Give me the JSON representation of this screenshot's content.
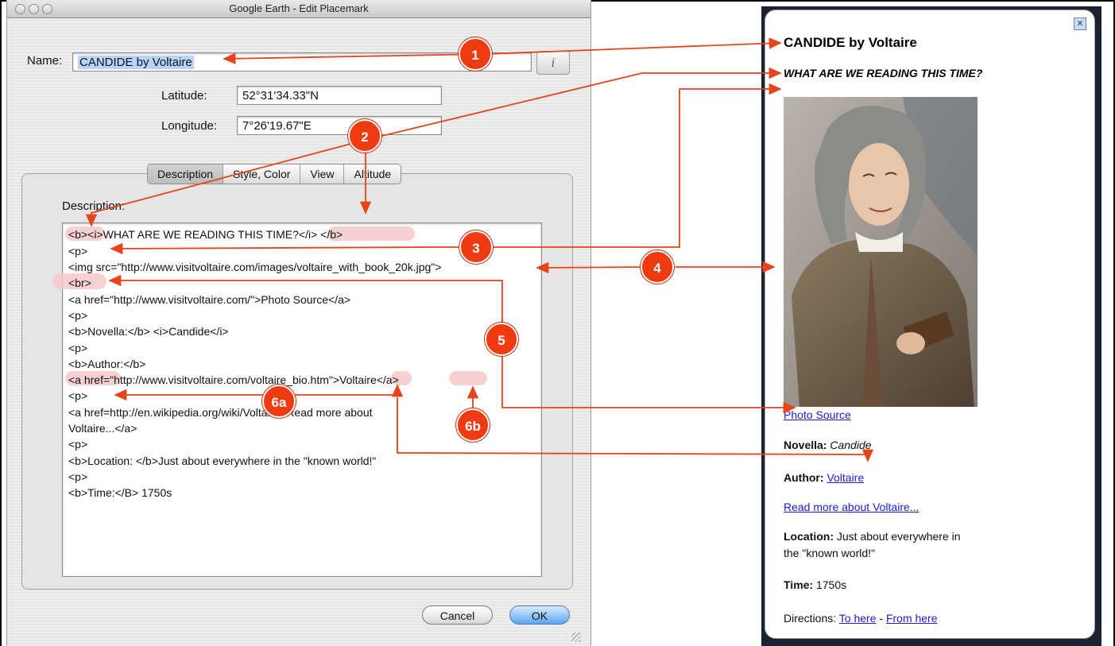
{
  "window": {
    "title": "Google Earth - Edit Placemark",
    "name_label": "Name:",
    "name_value": "CANDIDE by Voltaire",
    "info_button": "i",
    "latitude_label": "Latitude:",
    "latitude_value": "52°31'34.33\"N",
    "longitude_label": "Longitude:",
    "longitude_value": "7°26'19.67\"E",
    "tabs": [
      {
        "label": "Description",
        "active": true
      },
      {
        "label": "Style, Color",
        "active": false
      },
      {
        "label": "View",
        "active": false
      },
      {
        "label": "Altitude",
        "active": false
      }
    ],
    "description_label": "Description:",
    "description_lines": [
      "<b><i>WHAT ARE WE READING THIS TIME?</i> </b>",
      "<p>",
      "<img src=\"http://www.visitvoltaire.com/images/voltaire_with_book_20k.jpg\">",
      "<br>",
      "<a href=\"http://www.visitvoltaire.com/\">Photo Source</a>",
      "<p>",
      "<b>Novella:</b> <i>Candide</i>",
      "<p>",
      "<b>Author:</b>",
      "<a href=\"http://www.visitvoltaire.com/voltaire_bio.htm\">Voltaire</a>",
      "<p>",
      "<a href=http://en.wikipedia.org/wiki/Voltaire>Read more about",
      "Voltaire...</a>",
      "<p>",
      "<b>Location: </b>Just about everywhere in the \"known world!\"",
      "<p>",
      "<b>Time:</B> 1750s"
    ],
    "cancel_label": "Cancel",
    "ok_label": "OK"
  },
  "balloon": {
    "title": "CANDIDE by Voltaire",
    "subtitle": "WHAT ARE WE READING THIS TIME?",
    "photo_source": "Photo Source",
    "novella_label": "Novella:",
    "novella_value": "Candide",
    "author_label": "Author:",
    "author_value": "Voltaire",
    "read_more": "Read more about Voltaire...",
    "location_label": "Location:",
    "location_value_1": "Just about everywhere in",
    "location_value_2": "the \"known world!\"",
    "time_label": "Time:",
    "time_value": "1750s",
    "directions_label": "Directions:",
    "to_here": "To here",
    "separator": "-",
    "from_here": "From here"
  },
  "callouts": [
    "1",
    "2",
    "3",
    "4",
    "5",
    "6a",
    "6b"
  ],
  "colors": {
    "callout": "#f03a10",
    "arrow": "#e8431a",
    "highlight": "#f6c9c9",
    "link": "#1a1ae6"
  }
}
